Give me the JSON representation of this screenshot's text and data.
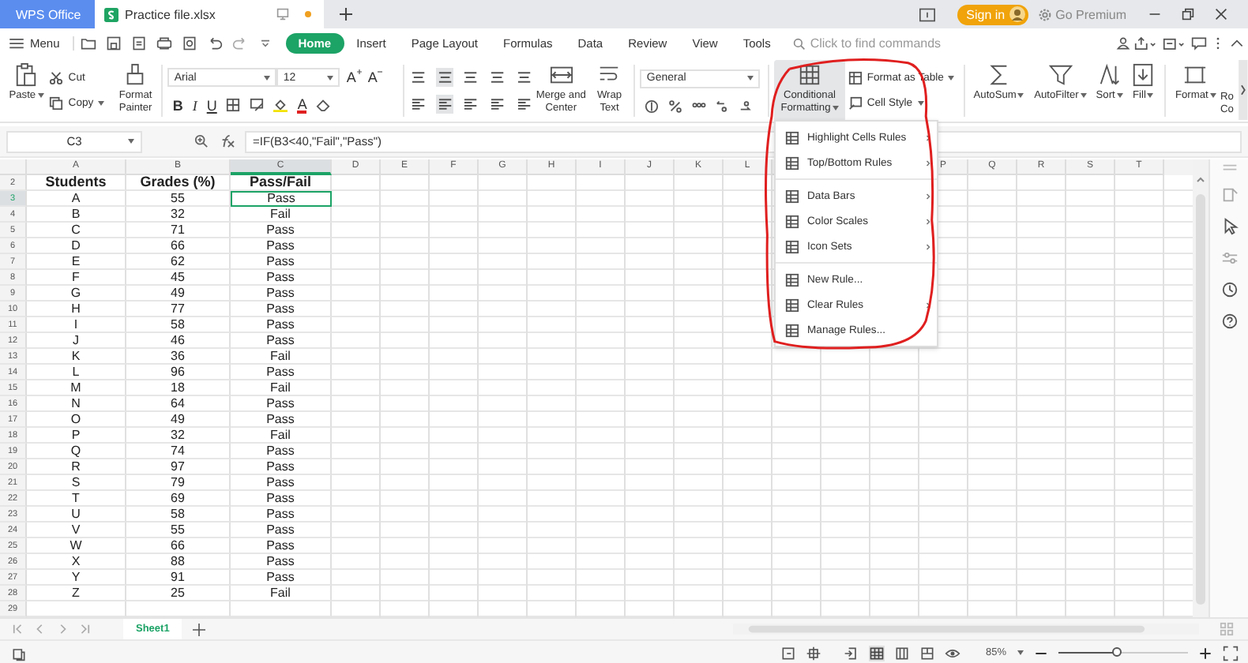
{
  "app_tabs": [
    {
      "label": "WPS Office",
      "kind": "home",
      "selected": false,
      "unsaved": false
    },
    {
      "label": "Practice file.xlsx",
      "kind": "document",
      "selected": true,
      "unsaved": true
    }
  ],
  "account": {
    "sign_in": "Sign in",
    "premium": "Go Premium"
  },
  "menu_button": "Menu",
  "ribbon_tabs": [
    {
      "label": "Home",
      "selected": true
    },
    {
      "label": "Insert",
      "selected": false
    },
    {
      "label": "Page Layout",
      "selected": false
    },
    {
      "label": "Formulas",
      "selected": false
    },
    {
      "label": "Data",
      "selected": false
    },
    {
      "label": "Review",
      "selected": false
    },
    {
      "label": "View",
      "selected": false
    },
    {
      "label": "Tools",
      "selected": false
    }
  ],
  "search": {
    "placeholder": "Click to find commands"
  },
  "ribbon": {
    "paste": "Paste",
    "cut": "Cut",
    "copy": "Copy",
    "format_painter": [
      "Format",
      "Painter"
    ],
    "font": "Arial",
    "font_size": "12",
    "grow_font": "A",
    "shrink_font": "A",
    "bold": "B",
    "italic": "I",
    "underline": "U",
    "font_color": "A",
    "merge_center": [
      "Merge and",
      "Center"
    ],
    "wrap_text": [
      "Wrap",
      "Text"
    ],
    "number_format": "General",
    "conditional_formatting": {
      "lines": [
        "Conditional",
        "Formatting"
      ],
      "expanded": true
    },
    "format_as_table": "Format as Table",
    "cell_style": "Cell Style",
    "autosum": "AutoSum",
    "autofilter": "AutoFilter",
    "sort": "Sort",
    "fill": "Fill",
    "format": "Format",
    "rows_columns": [
      "Ro",
      "Co"
    ]
  },
  "dropdown": {
    "groups": [
      [
        {
          "label": "Highlight Cells Rules",
          "submenu": true
        },
        {
          "label": "Top/Bottom Rules",
          "submenu": true
        }
      ],
      [
        {
          "label": "Data Bars",
          "submenu": true
        },
        {
          "label": "Color Scales",
          "submenu": true
        },
        {
          "label": "Icon Sets",
          "submenu": true
        }
      ],
      [
        {
          "label": "New Rule...",
          "submenu": false
        },
        {
          "label": "Clear Rules",
          "submenu": true
        },
        {
          "label": "Manage Rules...",
          "submenu": false
        }
      ]
    ]
  },
  "formula_bar": {
    "cell": "C3",
    "formula": "=IF(B3<40,\"Fail\",\"Pass\")"
  },
  "sheet": {
    "columns": [
      {
        "label": "A",
        "selected": false
      },
      {
        "label": "B",
        "selected": false
      },
      {
        "label": "C",
        "selected": true
      },
      {
        "label": "D",
        "selected": false
      },
      {
        "label": "E",
        "selected": false
      },
      {
        "label": "F",
        "selected": false
      },
      {
        "label": "G",
        "selected": false
      },
      {
        "label": "H",
        "selected": false
      },
      {
        "label": "I",
        "selected": false
      },
      {
        "label": "J",
        "selected": false
      },
      {
        "label": "K",
        "selected": false
      },
      {
        "label": "L",
        "selected": false
      }
    ],
    "columns_after_menu": [
      {
        "label": "P",
        "selected": false
      },
      {
        "label": "Q",
        "selected": false
      },
      {
        "label": "R",
        "selected": false
      },
      {
        "label": "S",
        "selected": false
      },
      {
        "label": "T",
        "selected": false
      }
    ],
    "rows": [
      {
        "number": "2",
        "kind": "header",
        "selected": false,
        "cells": [
          "Students",
          "Grades (%)",
          "Pass/Fail"
        ]
      },
      {
        "number": "3",
        "kind": "data",
        "selected": true,
        "cells": [
          "A",
          "55",
          "Pass"
        ]
      },
      {
        "number": "4",
        "kind": "data",
        "selected": false,
        "cells": [
          "B",
          "32",
          "Fail"
        ]
      },
      {
        "number": "5",
        "kind": "data",
        "selected": false,
        "cells": [
          "C",
          "71",
          "Pass"
        ]
      },
      {
        "number": "6",
        "kind": "data",
        "selected": false,
        "cells": [
          "D",
          "66",
          "Pass"
        ]
      },
      {
        "number": "7",
        "kind": "data",
        "selected": false,
        "cells": [
          "E",
          "62",
          "Pass"
        ]
      },
      {
        "number": "8",
        "kind": "data",
        "selected": false,
        "cells": [
          "F",
          "45",
          "Pass"
        ]
      },
      {
        "number": "9",
        "kind": "data",
        "selected": false,
        "cells": [
          "G",
          "49",
          "Pass"
        ]
      },
      {
        "number": "10",
        "kind": "data",
        "selected": false,
        "cells": [
          "H",
          "77",
          "Pass"
        ]
      },
      {
        "number": "11",
        "kind": "data",
        "selected": false,
        "cells": [
          "I",
          "58",
          "Pass"
        ]
      },
      {
        "number": "12",
        "kind": "data",
        "selected": false,
        "cells": [
          "J",
          "46",
          "Pass"
        ]
      },
      {
        "number": "13",
        "kind": "data",
        "selected": false,
        "cells": [
          "K",
          "36",
          "Fail"
        ]
      },
      {
        "number": "14",
        "kind": "data",
        "selected": false,
        "cells": [
          "L",
          "96",
          "Pass"
        ]
      },
      {
        "number": "15",
        "kind": "data",
        "selected": false,
        "cells": [
          "M",
          "18",
          "Fail"
        ]
      },
      {
        "number": "16",
        "kind": "data",
        "selected": false,
        "cells": [
          "N",
          "64",
          "Pass"
        ]
      },
      {
        "number": "17",
        "kind": "data",
        "selected": false,
        "cells": [
          "O",
          "49",
          "Pass"
        ]
      },
      {
        "number": "18",
        "kind": "data",
        "selected": false,
        "cells": [
          "P",
          "32",
          "Fail"
        ]
      },
      {
        "number": "19",
        "kind": "data",
        "selected": false,
        "cells": [
          "Q",
          "74",
          "Pass"
        ]
      },
      {
        "number": "20",
        "kind": "data",
        "selected": false,
        "cells": [
          "R",
          "97",
          "Pass"
        ]
      },
      {
        "number": "21",
        "kind": "data",
        "selected": false,
        "cells": [
          "S",
          "79",
          "Pass"
        ]
      },
      {
        "number": "22",
        "kind": "data",
        "selected": false,
        "cells": [
          "T",
          "69",
          "Pass"
        ]
      },
      {
        "number": "23",
        "kind": "data",
        "selected": false,
        "cells": [
          "U",
          "58",
          "Pass"
        ]
      },
      {
        "number": "24",
        "kind": "data",
        "selected": false,
        "cells": [
          "V",
          "55",
          "Pass"
        ]
      },
      {
        "number": "25",
        "kind": "data",
        "selected": false,
        "cells": [
          "W",
          "66",
          "Pass"
        ]
      },
      {
        "number": "26",
        "kind": "data",
        "selected": false,
        "cells": [
          "X",
          "88",
          "Pass"
        ]
      },
      {
        "number": "27",
        "kind": "data",
        "selected": false,
        "cells": [
          "Y",
          "91",
          "Pass"
        ]
      },
      {
        "number": "28",
        "kind": "data",
        "selected": false,
        "cells": [
          "Z",
          "25",
          "Fail"
        ]
      },
      {
        "number": "29",
        "selected": false
      }
    ]
  },
  "sheet_tabs": [
    {
      "label": "Sheet1",
      "selected": true
    }
  ],
  "status_bar": {
    "zoom": "85%",
    "zoom_slider": {
      "level": 0.45
    }
  }
}
